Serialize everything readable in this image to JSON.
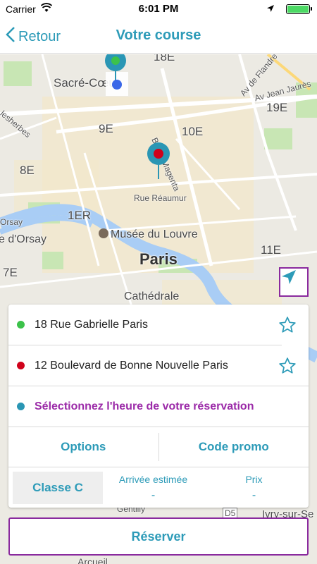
{
  "status_bar": {
    "carrier": "Carrier",
    "time": "6:01 PM",
    "icons": [
      "wifi-icon",
      "location-arrow-icon",
      "battery-icon"
    ]
  },
  "nav": {
    "back_label": "Retour",
    "title": "Votre course"
  },
  "map": {
    "labels": {
      "arr18": "18E",
      "sacre_coeur": "Sacré-Cœur",
      "arr19": "19E",
      "arr9": "9E",
      "arr10": "10E",
      "arr8": "8E",
      "arr1": "1ER",
      "arr11": "11E",
      "arr7": "7E",
      "musee_orsay": "e d'Orsay",
      "orsay": "Orsay",
      "louvre": "Musée du Louvre",
      "paris": "Paris",
      "cathedrale": "Cathédrale",
      "rue_reaumur": "Rue Réaumur",
      "bd_magenta": "Bd de Magenta",
      "av_jaures": "Av Jean Jaurès",
      "av_flandre": "Av de Flandre",
      "malesherbes": "lesherbes",
      "gentilly": "Gentilly",
      "ivry": "Ivry-sur-Se",
      "arcueil": "Arcueil",
      "d5": "D5"
    },
    "colors": {
      "origin": "#3cc24a",
      "destination": "#d0021b",
      "pin": "#2a96b4"
    }
  },
  "panel": {
    "origin_address": "18 Rue Gabrielle Paris",
    "destination_address": "12 Boulevard de Bonne Nouvelle Paris",
    "time_prompt": "Sélectionnez l'heure de votre réservation",
    "options_label": "Options",
    "promo_label": "Code promo",
    "class_label": "Classe C",
    "eta_label": "Arrivée estimée",
    "eta_value": "-",
    "price_label": "Prix",
    "price_value": "-"
  },
  "reserve_label": "Réserver",
  "accent_colors": {
    "primary": "#2d9bb8",
    "purple": "#8a2a9e"
  }
}
